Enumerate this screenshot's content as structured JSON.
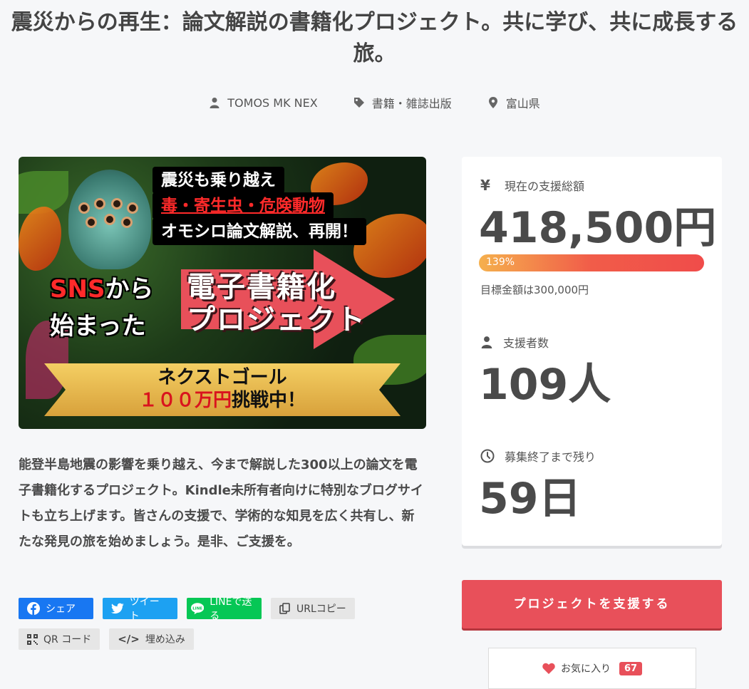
{
  "project": {
    "title": "震災からの再生：論文解説の書籍化プロジェクト。共に学び、共に成長する旅。",
    "owner": "TOMOS MK NEX",
    "category": "書籍・雑誌出版",
    "location": "富山県"
  },
  "hero_image": {
    "caption_line1": "震災も乗り越え",
    "caption_line2": "毒・寄生虫・危険動物",
    "caption_line3": "オモシロ論文解説、再開！",
    "sns_line1_red": "SNS",
    "sns_line1_white": "から",
    "sns_line2": "始まった",
    "ebook_line1": "電子書籍化",
    "ebook_line2": "プロジェクト",
    "ribbon_line1": "ネクストゴール",
    "ribbon_line2_red": "１００万円",
    "ribbon_line2_black": "挑戦中！"
  },
  "description": "能登半島地震の影響を乗り越え、今まで解説した300以上の論文を電子書籍化するプロジェクト。Kindle未所有者向けに特別なブログサイトも立ち上げます。皆さんの支援で、学術的な知見を広く共有し、新たな発見の旅を始めましょう。是非、ご支援を。",
  "share": {
    "facebook": "シェア",
    "twitter": "ツイート",
    "line": "LINEで送る",
    "url_copy": "URLコピー",
    "qr": "QR コード",
    "embed": "埋め込み"
  },
  "stats": {
    "total_label": "現在の支援総額",
    "total_icon": "yen-icon",
    "total_amount": "418,500円",
    "progress_percent": 139,
    "progress_label": "139%",
    "goal_text": "目標金額は300,000円",
    "supporters_label": "支援者数",
    "supporters_count": "109人",
    "remaining_label": "募集終了まで残り",
    "remaining_days": "59日"
  },
  "actions": {
    "support_button": "プロジェクトを支援する",
    "favorite_label": "お気に入り",
    "favorite_count": "67"
  },
  "colors": {
    "accent": "#e8505a",
    "facebook": "#1877f2",
    "twitter": "#1da1f2",
    "line": "#06c755"
  }
}
